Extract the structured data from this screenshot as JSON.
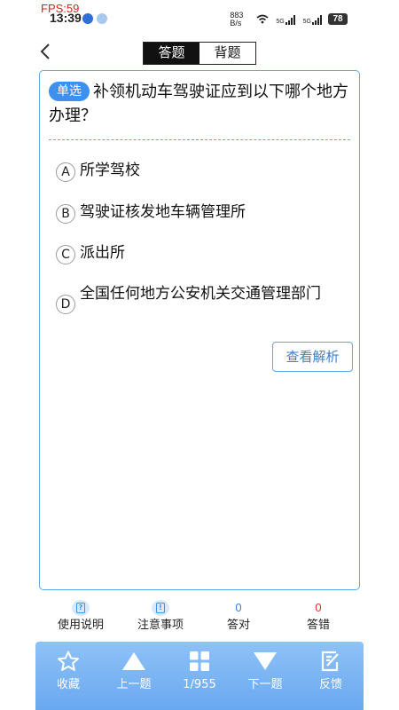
{
  "fps_label": "FPS:59",
  "status": {
    "time": "13:39",
    "net_speed": "883 B/s",
    "signal1": "5G",
    "signal2": "5G",
    "battery": "78"
  },
  "header": {
    "back_icon": "chevron-left-icon",
    "tabs": [
      {
        "label": "答题",
        "active": true
      },
      {
        "label": "背题",
        "active": false
      }
    ]
  },
  "question": {
    "type_badge": "单选",
    "text": "补领机动车驾驶证应到以下哪个地方办理？",
    "options": [
      {
        "letter": "A",
        "text": "所学驾校"
      },
      {
        "letter": "B",
        "text": "驾驶证核发地车辆管理所"
      },
      {
        "letter": "C",
        "text": "派出所"
      },
      {
        "letter": "D",
        "text": "全国任何地方公安机关交通管理部门"
      }
    ],
    "analysis_label": "查看解析"
  },
  "info_row": {
    "usage": {
      "label": "使用说明",
      "icon": "help-doc-icon"
    },
    "notice": {
      "label": "注意事项",
      "icon": "notice-doc-icon"
    },
    "correct": {
      "label": "答对",
      "count": "0",
      "color": "#3a7fd0"
    },
    "wrong": {
      "label": "答错",
      "count": "0",
      "color": "#e03030"
    }
  },
  "bottom_bar": {
    "favorite": {
      "label": "收藏",
      "icon": "star-icon"
    },
    "prev": {
      "label": "上一题",
      "icon": "triangle-up-icon"
    },
    "progress": {
      "label": "1/955",
      "icon": "grid-icon"
    },
    "next": {
      "label": "下一题",
      "icon": "triangle-down-icon"
    },
    "feedback": {
      "label": "反馈",
      "icon": "edit-icon"
    }
  },
  "colors": {
    "accent": "#3d8ff0",
    "card_border": "#5aa9e8",
    "bottom_bar": "#7fb6f4"
  }
}
